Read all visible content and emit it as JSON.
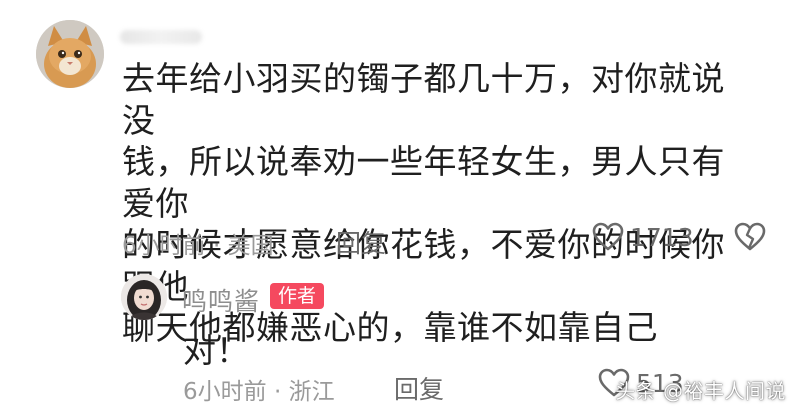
{
  "comment": {
    "text": "去年给小羽买的镯子都几十万，对你就说没\n钱，所以说奉劝一些年轻女生，男人只有爱你\n的时候才愿意给你花钱，不爱你的时候你跟他\n聊天他都嫌恶心的，靠谁不如靠自己",
    "meta": "6小时前 · 美国",
    "reply_label": "回复",
    "like_count": "1713",
    "avatar_icon": "cat-avatar",
    "like_icon": "heart-outline-icon",
    "dislike_icon": "broken-heart-icon"
  },
  "reply": {
    "username": "鸣鸣酱",
    "badge": "作者",
    "text": "对！",
    "meta": "6小时前 · 浙江",
    "reply_label": "回复",
    "like_count": "513",
    "avatar_icon": "girl-avatar",
    "like_icon": "heart-outline-icon"
  },
  "watermark": "头条 @裕丰人间说",
  "colors": {
    "text": "#1f1f1f",
    "meta": "#9a9a9a",
    "badge_bg": "#f5495f",
    "icon": "#6a6a6a"
  }
}
